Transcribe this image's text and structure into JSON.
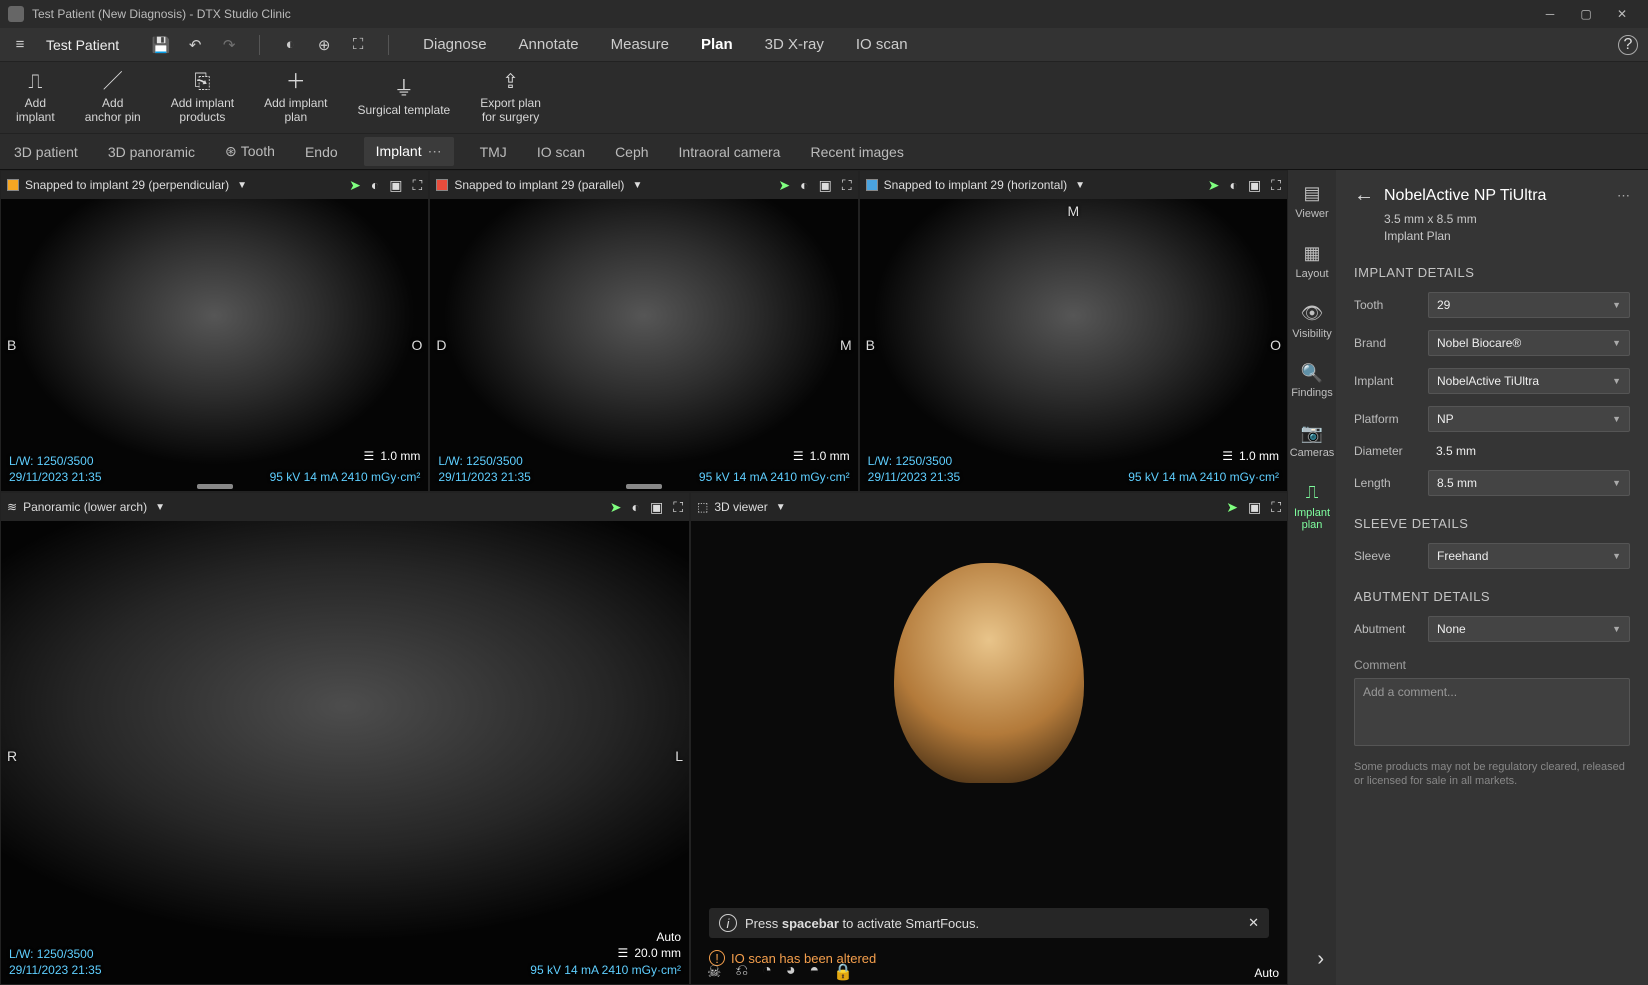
{
  "titlebar": {
    "title": "Test Patient (New Diagnosis) - DTX Studio Clinic"
  },
  "toolbar": {
    "patient": "Test Patient",
    "tabs": [
      "Diagnose",
      "Annotate",
      "Measure",
      "Plan",
      "3D X-ray",
      "IO scan"
    ],
    "activeTab": "Plan"
  },
  "ribbon": {
    "items": [
      "Add\nimplant",
      "Add\nanchor pin",
      "Add implant\nproducts",
      "Add implant\nplan",
      "Surgical template",
      "Export plan\nfor surgery"
    ]
  },
  "workspaces": {
    "items": [
      "3D patient",
      "3D panoramic",
      "Tooth",
      "Endo",
      "Implant",
      "TMJ",
      "IO scan",
      "Ceph",
      "Intraoral camera",
      "Recent images"
    ],
    "active": "Implant"
  },
  "panes": {
    "p1": {
      "title": "Snapped to implant 29 (perpendicular)",
      "lw": "L/W: 1250/3500",
      "dt": "29/11/2023 21:35",
      "dose": "95 kV  14 mA  2410 mGy·cm²",
      "slice": "1.0 mm",
      "left": "B",
      "right": "O"
    },
    "p2": {
      "title": "Snapped to implant 29 (parallel)",
      "lw": "L/W: 1250/3500",
      "dt": "29/11/2023 21:35",
      "dose": "95 kV  14 mA  2410 mGy·cm²",
      "slice": "1.0 mm",
      "left": "D",
      "right": "M"
    },
    "p3": {
      "title": "Snapped to implant 29 (horizontal)",
      "lw": "L/W: 1250/3500",
      "dt": "29/11/2023 21:35",
      "dose": "95 kV  14 mA  2410 mGy·cm²",
      "slice": "1.0 mm",
      "left": "B",
      "right": "O",
      "top": "M"
    },
    "p4": {
      "title": "Panoramic (lower arch)",
      "lw": "L/W: 1250/3500",
      "dt": "29/11/2023 21:35",
      "dose": "95 kV  14 mA  2410 mGy·cm²",
      "slice": "20.0 mm",
      "left": "R",
      "right": "L",
      "auto": "Auto"
    },
    "p5": {
      "title": "3D viewer",
      "auto": "Auto",
      "hint_pre": "Press ",
      "hint_bold": "spacebar",
      "hint_post": " to activate SmartFocus.",
      "warn": "IO scan has been altered"
    }
  },
  "sideIcons": [
    "Viewer",
    "Layout",
    "Visibility",
    "Findings",
    "Cameras",
    "Implant\nplan"
  ],
  "props": {
    "title": "NobelActive NP TiUltra",
    "sub1": "3.5 mm x 8.5 mm",
    "sub2": "Implant Plan",
    "section_implant": "IMPLANT DETAILS",
    "section_sleeve": "SLEEVE DETAILS",
    "section_abut": "ABUTMENT DETAILS",
    "fields": {
      "tooth_l": "Tooth",
      "tooth_v": "29",
      "brand_l": "Brand",
      "brand_v": "Nobel Biocare®",
      "implant_l": "Implant",
      "implant_v": "NobelActive TiUltra",
      "platform_l": "Platform",
      "platform_v": "NP",
      "diameter_l": "Diameter",
      "diameter_v": "3.5 mm",
      "length_l": "Length",
      "length_v": "8.5 mm",
      "sleeve_l": "Sleeve",
      "sleeve_v": "Freehand",
      "abut_l": "Abutment",
      "abut_v": "None"
    },
    "comment_l": "Comment",
    "comment_ph": "Add a comment...",
    "disclaimer": "Some products may not be regulatory cleared, released or licensed for sale in all markets."
  }
}
